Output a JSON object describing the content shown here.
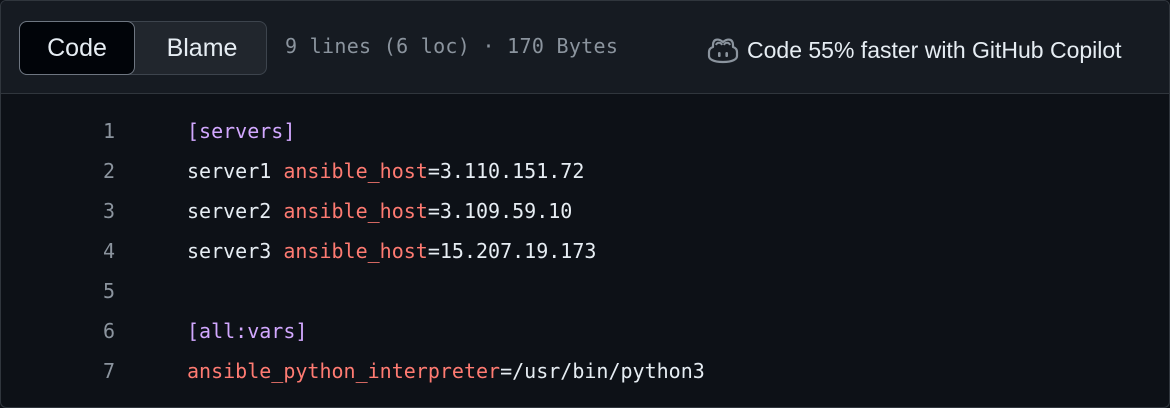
{
  "tabs": {
    "code": "Code",
    "blame": "Blame"
  },
  "file_meta": "9 lines (6 loc) · 170 Bytes",
  "copilot": {
    "icon": "copilot-icon",
    "label": "Code 55% faster with GitHub Copilot"
  },
  "lines": [
    {
      "num": "1",
      "section": "[servers]"
    },
    {
      "num": "2",
      "name": "server1 ",
      "key": "ansible_host",
      "value": "=3.110.151.72"
    },
    {
      "num": "3",
      "name": "server2 ",
      "key": "ansible_host",
      "value": "=3.109.59.10"
    },
    {
      "num": "4",
      "name": "server3 ",
      "key": "ansible_host",
      "value": "=15.207.19.173"
    },
    {
      "num": "5"
    },
    {
      "num": "6",
      "section": "[all:vars]"
    },
    {
      "num": "7",
      "key": "ansible_python_interpreter",
      "value": "=/usr/bin/python3"
    }
  ],
  "colors": {
    "background": "#0d1117",
    "header": "#161b22",
    "section": "#d2a8ff",
    "key": "#ff7b72",
    "text": "#e6edf3",
    "muted": "#8b949e"
  }
}
